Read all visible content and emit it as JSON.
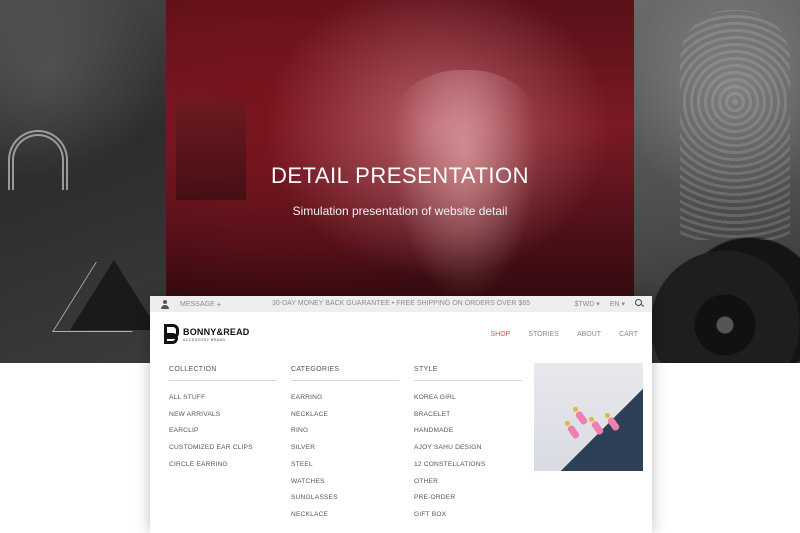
{
  "hero": {
    "title": "DETAIL PRESENTATION",
    "subtitle": "Simulation presentation of website detail"
  },
  "topbar": {
    "message_label": "MESSAGE",
    "message_plus": "+",
    "promo": "30-DAY MONEY BACK GUARANTEE • FREE SHIPPING ON ORDERS OVER $65",
    "currency": "$TWD ▾",
    "language": "EN ▾"
  },
  "brand": {
    "name": "BONNY&READ",
    "tagline": "ACCESSORY BRAND"
  },
  "nav": {
    "items": [
      "SHOP",
      "STORIES",
      "ABOUT",
      "CART"
    ],
    "active": "SHOP",
    "active_color": "#d9534f"
  },
  "menu": {
    "columns": [
      {
        "heading": "COLLECTION",
        "items": [
          "ALL STUFF",
          "NEW ARRIVALS",
          "EARCLIP",
          "CUSTOMIZED EAR CLIPS",
          "CIRCLE EARRING"
        ]
      },
      {
        "heading": "CATEGORIES",
        "items": [
          "EARRING",
          "NECKLACE",
          "RING",
          "SILVER",
          "STEEL",
          "WATCHES",
          "SUNGLASSES",
          "NECKLACE"
        ]
      },
      {
        "heading": "STYLE",
        "items": [
          "KOREA GIRL",
          "BRACELET",
          "HANDMADE",
          "AJOY SAHU DESIGN",
          "12 CONSTELLATIONS",
          "OTHER",
          "PRE-ORDER",
          "GIFT BOX"
        ]
      }
    ]
  },
  "icons": {
    "user": "user-icon",
    "search": "search-icon"
  }
}
